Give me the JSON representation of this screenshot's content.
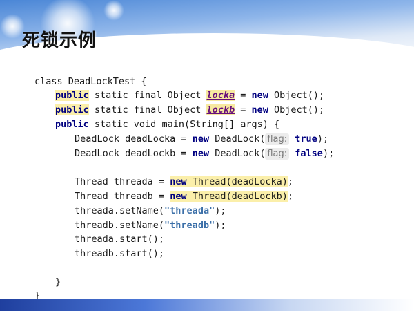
{
  "slide": {
    "title": "死锁示例"
  },
  "code": {
    "l1": {
      "a": "class DeadLockTest {"
    },
    "l2": {
      "kw1": "public",
      "b": " static final Object ",
      "field": "locka",
      "c": " = ",
      "kw2": "new",
      "d": " Object();"
    },
    "l3": {
      "kw1": "public",
      "b": " static final Object ",
      "field": "lockb",
      "c": " = ",
      "kw2": "new",
      "d": " Object();"
    },
    "l4": {
      "kw1": "public",
      "b": " static void main(String[] args) {"
    },
    "l5": {
      "a": "DeadLock deadLocka = ",
      "kw": "new",
      "b": " DeadLock(",
      "hint": "flag:",
      "kw2": "true",
      "c": ");"
    },
    "l6": {
      "a": "DeadLock deadLockb = ",
      "kw": "new",
      "b": " DeadLock(",
      "hint": "flag:",
      "kw2": "false",
      "c": ");"
    },
    "l7": {
      "a": "Thread ",
      "var": "threada",
      "b": " = ",
      "kw": "new",
      "c": " Thread(deadLocka)",
      "d": ";"
    },
    "l8": {
      "a": "Thread ",
      "var": "threadb",
      "b": " = ",
      "kw": "new",
      "c": " Thread(deadLockb)",
      "d": ";"
    },
    "l9": {
      "a": "threada.setName(",
      "str": "\"threada\"",
      "b": ");"
    },
    "l10": {
      "a": "threadb.setName(",
      "str": "\"threadb\"",
      "b": ");"
    },
    "l11": {
      "a": "threada.start();"
    },
    "l12": {
      "a": "threadb.start();"
    },
    "l13": {
      "a": "}"
    },
    "l14": {
      "a": "}"
    }
  }
}
